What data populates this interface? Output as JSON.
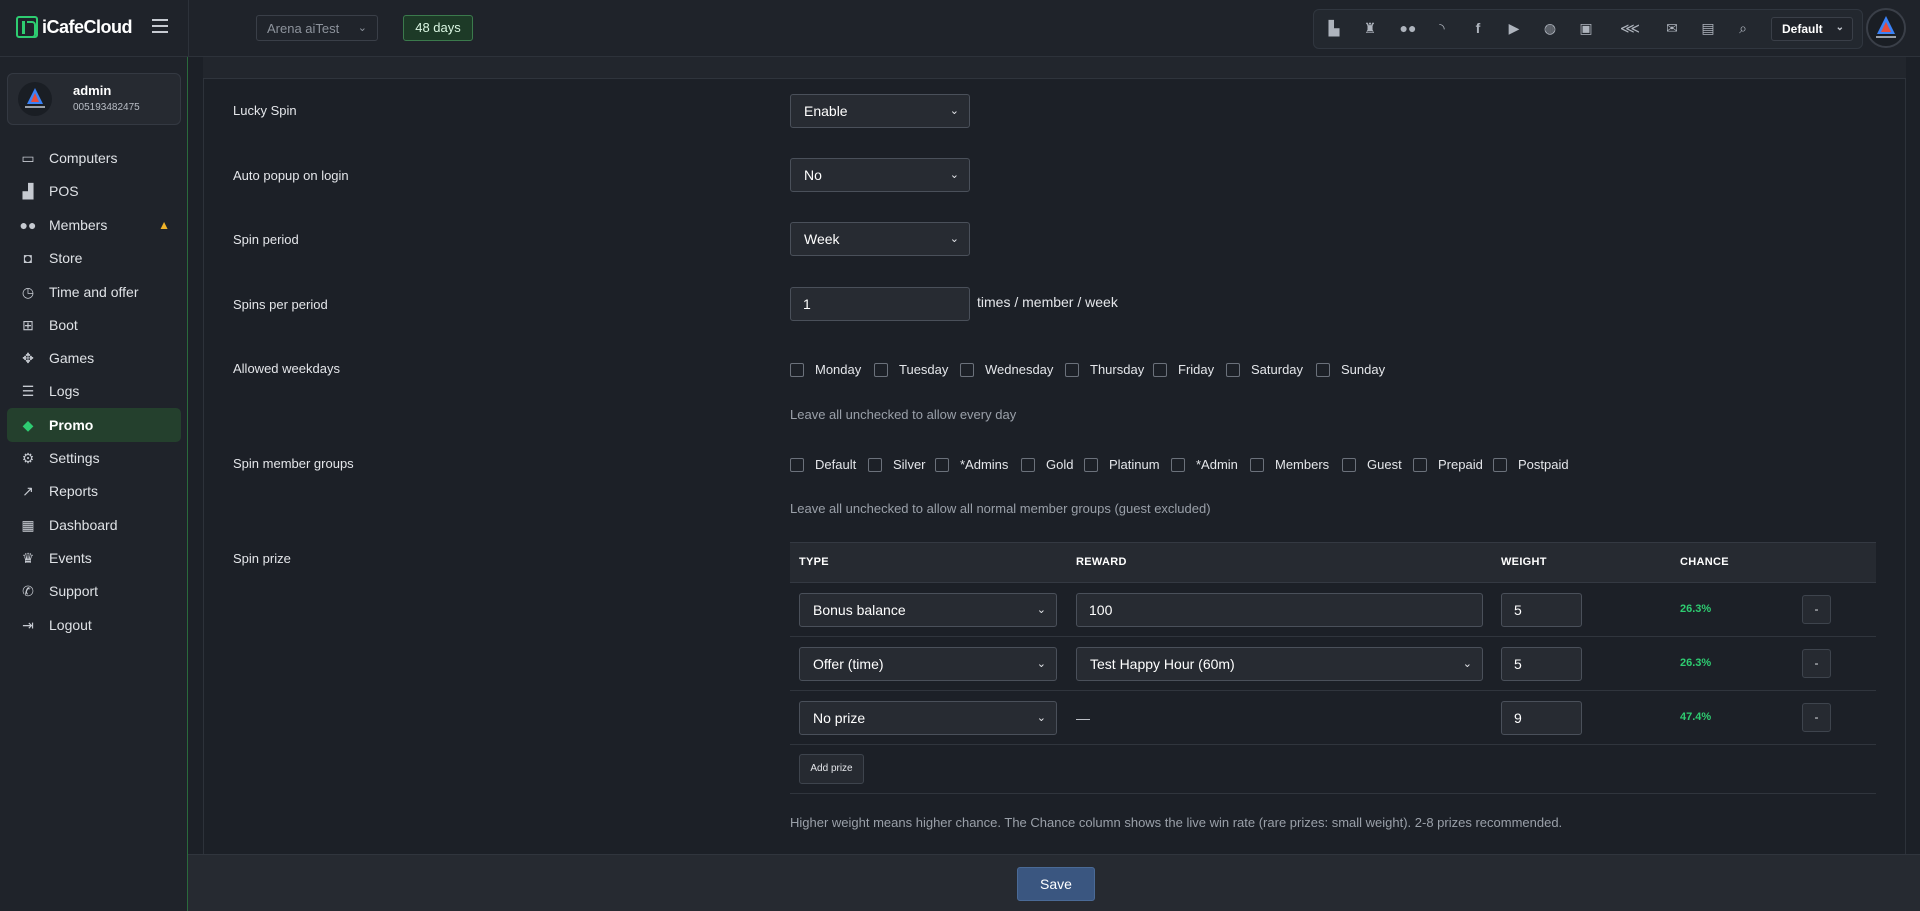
{
  "app": {
    "logo_text": "iCafeCloud"
  },
  "header": {
    "arena_select": "Arena aiTest",
    "days_badge": "48 days",
    "theme_select": "Default",
    "toolbar_icons": [
      "leaderboard-icon",
      "trophy-icon",
      "users-icon",
      "rss-icon",
      "facebook-icon",
      "youtube-icon",
      "globe-icon",
      "icafe-icon",
      "handshake-icon",
      "mail-icon",
      "chat-icon",
      "search-icon"
    ]
  },
  "user": {
    "name": "admin",
    "id": "005193482475"
  },
  "sidebar": {
    "items": [
      {
        "label": "Computers",
        "icon": "monitor-icon"
      },
      {
        "label": "POS",
        "icon": "pos-icon"
      },
      {
        "label": "Members",
        "icon": "members-icon"
      },
      {
        "label": "Store",
        "icon": "bag-icon"
      },
      {
        "label": "Time and offer",
        "icon": "stopwatch-icon"
      },
      {
        "label": "Boot",
        "icon": "windows-icon"
      },
      {
        "label": "Games",
        "icon": "gamepad-icon"
      },
      {
        "label": "Logs",
        "icon": "list-icon"
      },
      {
        "label": "Promo",
        "icon": "tag-icon",
        "active": true
      },
      {
        "label": "Settings",
        "icon": "gear-icon"
      },
      {
        "label": "Reports",
        "icon": "chart-icon"
      },
      {
        "label": "Dashboard",
        "icon": "dashboard-icon"
      },
      {
        "label": "Events",
        "icon": "crown-icon"
      },
      {
        "label": "Support",
        "icon": "phone-icon"
      },
      {
        "label": "Logout",
        "icon": "logout-icon"
      }
    ]
  },
  "form": {
    "lucky_spin": {
      "label": "Lucky Spin",
      "value": "Enable"
    },
    "auto_popup": {
      "label": "Auto popup on login",
      "value": "No"
    },
    "spin_period": {
      "label": "Spin period",
      "value": "Week"
    },
    "spins_per_period": {
      "label": "Spins per period",
      "value": "1",
      "suffix": "times / member / week"
    },
    "allowed_weekdays": {
      "label": "Allowed weekdays",
      "options": [
        "Monday",
        "Tuesday",
        "Wednesday",
        "Thursday",
        "Friday",
        "Saturday",
        "Sunday"
      ],
      "help": "Leave all unchecked to allow every day"
    },
    "member_groups": {
      "label": "Spin member groups",
      "options": [
        "Default",
        "Silver",
        "*Admins",
        "Gold",
        "Platinum",
        "*Admin",
        "Members",
        "Guest",
        "Prepaid",
        "Postpaid"
      ],
      "help": "Leave all unchecked to allow all normal member groups (guest excluded)"
    },
    "spin_prize": {
      "label": "Spin prize",
      "headers": {
        "type": "TYPE",
        "reward": "REWARD",
        "weight": "WEIGHT",
        "chance": "CHANCE"
      },
      "rows": [
        {
          "type": "Bonus balance",
          "reward": "100",
          "weight": "5",
          "chance": "26.3%",
          "remove": "-"
        },
        {
          "type": "Offer (time)",
          "reward": "Test Happy Hour (60m)",
          "weight": "5",
          "chance": "26.3%",
          "remove": "-"
        },
        {
          "type": "No prize",
          "reward": "—",
          "weight": "9",
          "chance": "47.4%",
          "remove": "-"
        }
      ],
      "add_label": "Add prize",
      "help": "Higher weight means higher chance. The Chance column shows the live win rate (rare prizes: small weight). 2-8 prizes recommended."
    }
  },
  "footer": {
    "save_label": "Save"
  },
  "colors": {
    "accent": "#2ecc71",
    "active_bg": "#24402d",
    "save_bg": "#3a5680",
    "warn": "#f0b429"
  }
}
